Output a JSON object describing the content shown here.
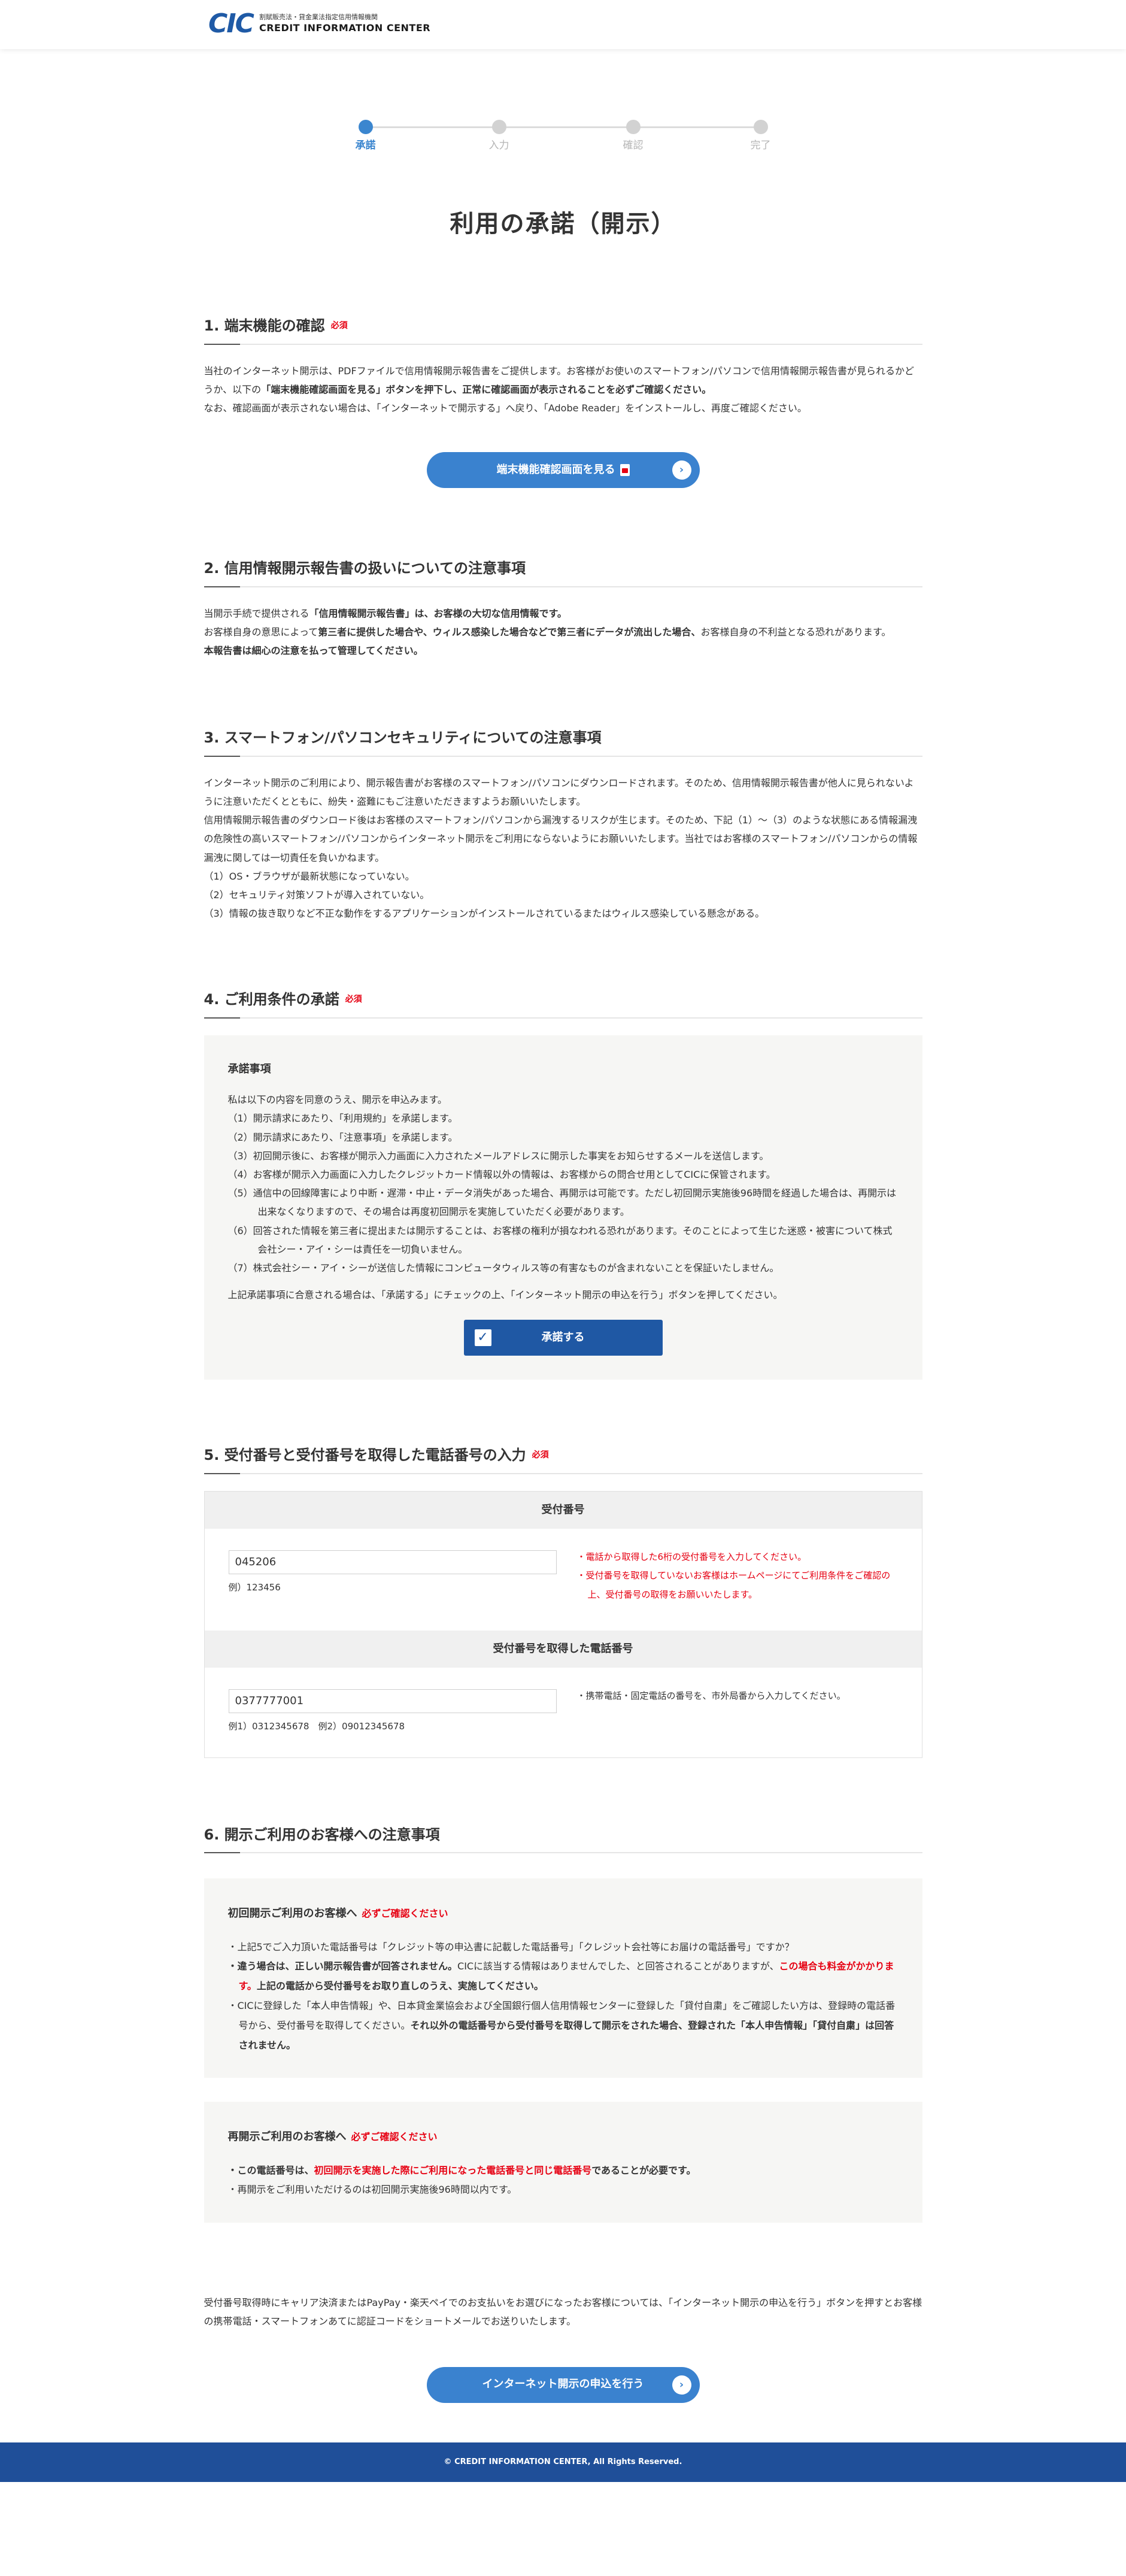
{
  "header": {
    "logo_mark": "CIC",
    "logo_sub": "割賦販売法・貸金業法指定信用情報機関",
    "logo_main": "CREDIT INFORMATION CENTER"
  },
  "stepper": {
    "steps": [
      {
        "label": "承諾",
        "active": true
      },
      {
        "label": "入力",
        "active": false
      },
      {
        "label": "確認",
        "active": false
      },
      {
        "label": "完了",
        "active": false
      }
    ]
  },
  "page_title": "利用の承諾（開示）",
  "sections": {
    "s1": {
      "title": "1. 端末機能の確認",
      "required": "必須",
      "p1a": "当社のインターネット開示は、PDFファイルで信用情報開示報告書をご提供します。お客様がお使いのスマートフォン/パソコンで信用情報開示報告書が見られるかどうか、以下の",
      "p1b": "「端末機能確認画面を見る」ボタンを押下し、正常に確認画面が表示されることを必ずご確認ください。",
      "p2": "なお、確認画面が表示されない場合は、「インターネットで開示する」へ戻り、「Adobe Reader」をインストールし、再度ご確認ください。",
      "button": "端末機能確認画面を見る",
      "button_arrow": "›"
    },
    "s2": {
      "title": "2. 信用情報開示報告書の扱いについての注意事項",
      "l1a": "当開示手続で提供される",
      "l1b": "「信用情報開示報告書」は、お客様の大切な信用情報です。",
      "l2a": "お客様自身の意思によって",
      "l2b": "第三者に提供した場合や、ウィルス感染した場合などで第三者にデータが流出した場合、",
      "l2c": "お客様自身の不利益となる恐れがあります。",
      "l3": "本報告書は細心の注意を払って管理してください。"
    },
    "s3": {
      "title": "3. スマートフォン/パソコンセキュリティについての注意事項",
      "p1": "インターネット開示のご利用により、開示報告書がお客様のスマートフォン/パソコンにダウンロードされます。そのため、信用情報開示報告書が他人に見られないように注意いただくとともに、紛失・盗難にもご注意いただきますようお願いいたします。",
      "p2": "信用情報開示報告書のダウンロード後はお客様のスマートフォン/パソコンから漏洩するリスクが生じます。そのため、下記（1）～（3）のような状態にある情報漏洩の危険性の高いスマートフォン/パソコンからインターネット開示をご利用にならないようにお願いいたします。当社ではお客様のスマートフォン/パソコンからの情報漏洩に関しては一切責任を負いかねます。",
      "items": [
        "（1）OS・ブラウザが最新状態になっていない。",
        "（2）セキュリティ対策ソフトが導入されていない。",
        "（3）情報の抜き取りなど不正な動作をするアプリケーションがインストールされているまたはウィルス感染している懸念がある。"
      ]
    },
    "s4": {
      "title": "4. ご利用条件の承諾",
      "required": "必須",
      "box_title": "承諾事項",
      "intro": "私は以下の内容を同意のうえ、開示を申込みます。",
      "items": [
        "（1）開示請求にあたり、「利用規約」を承諾します。",
        "（2）開示請求にあたり、「注意事項」を承諾します。",
        "（3）初回開示後に、お客様が開示入力画面に入力されたメールアドレスに開示した事実をお知らせするメールを送信します。",
        "（4）お客様が開示入力画面に入力したクレジットカード情報以外の情報は、お客様からの問合せ用としてCICに保管されます。",
        "（5）通信中の回線障害により中断・遅滞・中止・データ消失があった場合、再開示は可能です。ただし初回開示実施後96時間を経過した場合は、再開示は出来なくなりますので、その場合は再度初回開示を実施していただく必要があります。",
        "（6）回答された情報を第三者に提出または開示することは、お客様の権利が損なわれる恐れがあります。そのことによって生じた迷惑・被害について株式会社シー・アイ・シーは責任を一切負いません。",
        "（7）株式会社シー・アイ・シーが送信した情報にコンピュータウィルス等の有害なものが含まれないことを保証いたしません。"
      ],
      "outro": "上記承諾事項に合意される場合は、「承諾する」にチェックの上、「インターネット開示の申込を行う」ボタンを押してください。",
      "agree_label": "承諾する",
      "agree_check": "✓"
    },
    "s5": {
      "title": "5. 受付番号と受付番号を取得した電話番号の入力",
      "required": "必須",
      "receipt": {
        "header": "受付番号",
        "value": "045206",
        "example": "例）123456",
        "note1": "・電話から取得した6桁の受付番号を入力してください。",
        "note2": "・受付番号を取得していないお客様はホームページにてご利用条件をご確認の上、受付番号の取得をお願いいたします。"
      },
      "phone": {
        "header": "受付番号を取得した電話番号",
        "value": "0377777001",
        "example": "例1）0312345678　例2）09012345678",
        "note": "・携帯電話・固定電話の番号を、市外局番から入力してください。"
      }
    },
    "s6": {
      "title": "6. 開示ご利用のお客様への注意事項",
      "first": {
        "title": "初回開示ご利用のお客様へ",
        "must": "必ずご確認ください",
        "b1": "・上記5でご入力頂いた電話番号は「クレジット等の申込書に記載した電話番号」「クレジット会社等にお届けの電話番号」ですか？",
        "b2a": "・違う場合は、正しい開示報告書が回答されません。",
        "b2b": "CICに該当する情報はありませんでした、と回答されることがありますが、",
        "b2c": "この場合も料金がかかります。",
        "b2d": "上記の電話から受付番号をお取り直しのうえ、実施してください。",
        "b3a": "・CICに登録した「本人申告情報」や、日本貸金業協会および全国銀行個人信用情報センターに登録した「貸付自粛」をご確認したい方は、登録時の電話番号から、受付番号を取得してください。",
        "b3b": "それ以外の電話番号から受付番号を取得して開示をされた場合、登録された「本人申告情報」「貸付自粛」は回答されません。"
      },
      "re": {
        "title": "再開示ご利用のお客様へ",
        "must": "必ずご確認ください",
        "b1a": "・この電話番号は、",
        "b1b": "初回開示を実施した際にご利用になった電話番号と同じ電話番号",
        "b1c": "であることが必要です。",
        "b2": "・再開示をご利用いただけるのは初回開示実施後96時間以内です。"
      }
    }
  },
  "bottom": {
    "note": "受付番号取得時にキャリア決済またはPayPay・楽天ペイでのお支払いをお選びになったお客様については、「インターネット開示の申込を行う」ボタンを押すとお客様の携帯電話・スマートフォンあてに認証コードをショートメールでお送りいたします。",
    "submit": "インターネット開示の申込を行う",
    "submit_arrow": "›"
  },
  "footer": {
    "copyright": "© CREDIT INFORMATION CENTER, All Rights Reserved."
  }
}
